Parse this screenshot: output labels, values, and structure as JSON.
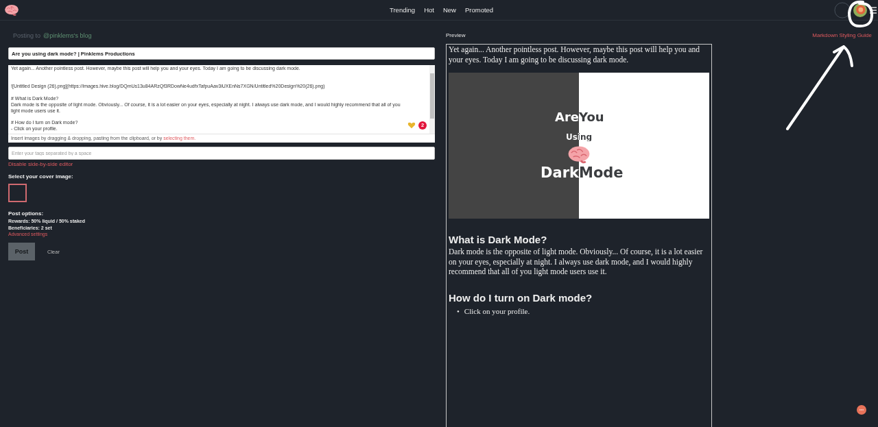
{
  "nav": {
    "links": [
      {
        "label": "Trending"
      },
      {
        "label": "Hot"
      },
      {
        "label": "New"
      },
      {
        "label": "Promoted"
      }
    ]
  },
  "editor": {
    "posting_to": "Posting to",
    "community": "@pinklems's blog",
    "title": "Are you using dark mode? | Pinklems Productions",
    "body": "Yet again... Another pointless post. However, maybe this post will help you and your eyes. Today I am going to be discussing dark mode.\n\n\n![Untitled Design (26).png](https://images.hive.blog/DQmUs13u84ARzQf3RDowNe4udfxTafpuAav3iUXEnNs7XGN/Untitled%20Design%20(26).png)\n\n# What is Dark Mode?\nDark mode is the opposite of light mode. Obviously... Of course, it is a lot easier on your eyes, especially at night. I always use dark mode, and I would highly recommend that all of you light mode users use it.\n\n# How do I turn on Dark mode?\n- Click on your profile.",
    "issue_count": "2",
    "upload_hint": "Insert images by dragging & dropping, pasting from the clipboard, or by",
    "upload_link": "selecting them.",
    "tags_placeholder": "Enter your tags separated by a space",
    "toggle_link": "Disable side-by-side editor",
    "cover_label": "Select your cover image:",
    "options_label": "Post options:",
    "options": [
      "Rewards: 50% liquid / 50% staked",
      "Beneficiaries: 2 set"
    ],
    "advanced_link": "Advanced settings",
    "post_button": {
      "label": "Post",
      "disabled": true
    },
    "clear_button": "Clear"
  },
  "preview": {
    "label": "Preview",
    "guide_link": "Markdown Styling Guide",
    "blocks": [
      {
        "kind": "paragraph",
        "text": "Yet again... Another pointless post. However, maybe this post will help you and your eyes. Today I am going to be discussing dark mode."
      },
      {
        "kind": "image",
        "lines": [
          [
            "Are",
            "You"
          ],
          [
            "Using"
          ],
          [
            "Dark",
            "Mode"
          ]
        ]
      },
      {
        "kind": "heading",
        "text": "What is Dark Mode?"
      },
      {
        "kind": "paragraph",
        "text": "Dark mode is the opposite of light mode. Obviously... Of course, it is a lot easier on your eyes, especially at night. I always use dark mode, and I would highly recommend that all of you light mode users use it."
      },
      {
        "kind": "heading",
        "text": "How do I turn on Dark mode?"
      },
      {
        "kind": "list",
        "marker": "•",
        "items": [
          "Click on your profile."
        ]
      }
    ]
  }
}
